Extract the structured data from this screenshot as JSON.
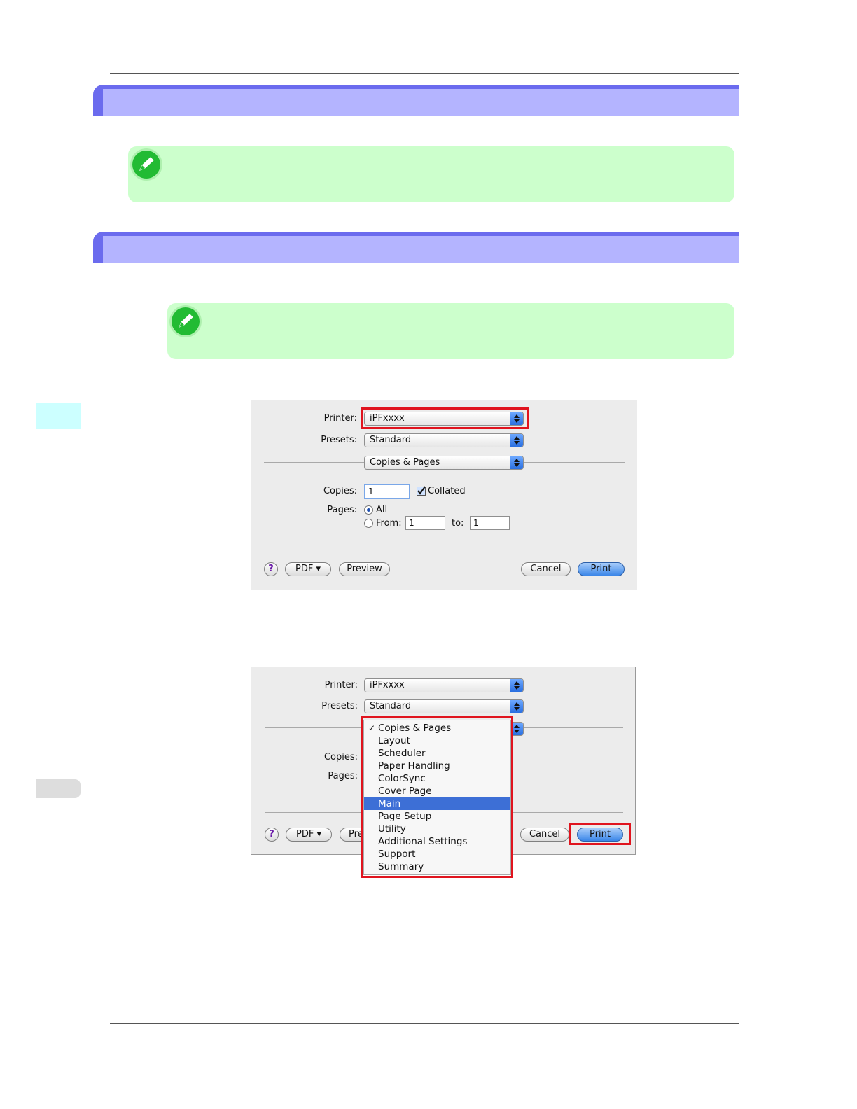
{
  "dialog1": {
    "printer_label": "Printer:",
    "printer_value": "iPFxxxx",
    "presets_label": "Presets:",
    "presets_value": "Standard",
    "panel_value": "Copies & Pages",
    "copies_label": "Copies:",
    "copies_value": "1",
    "collated_label": "Collated",
    "pages_label": "Pages:",
    "all_label": "All",
    "from_label": "From:",
    "from_value": "1",
    "to_label": "to:",
    "to_value": "1",
    "help_label": "?",
    "pdf_label": "PDF ▾",
    "preview_label": "Preview",
    "cancel_label": "Cancel",
    "print_label": "Print"
  },
  "dialog2": {
    "printer_label": "Printer:",
    "printer_value": "iPFxxxx",
    "presets_label": "Presets:",
    "presets_value": "Standard",
    "copies_label": "Copies:",
    "pages_label": "Pages:",
    "help_label": "?",
    "pdf_label": "PDF ▾",
    "preview_label_partial": "Pre",
    "cancel_label": "Cancel",
    "print_label": "Print",
    "menu_check": "✓",
    "menu_items": [
      "Copies & Pages",
      "Layout",
      "Scheduler",
      "Paper Handling",
      "ColorSync",
      "Cover Page",
      "Main",
      "Page Setup",
      "Utility",
      "Additional Settings",
      "Support",
      "Summary"
    ],
    "menu_selected": "Main"
  },
  "colors": {
    "section_bar": "#b4b4ff",
    "section_accent": "#6b6bee",
    "note_bg": "#ccffcc",
    "highlight": "#e0141e",
    "side_tab_1": "#ccffff",
    "side_tab_2": "#dddddd"
  },
  "icons": [
    "note-pencil-icon",
    "popup-arrows-icon",
    "help-icon"
  ]
}
